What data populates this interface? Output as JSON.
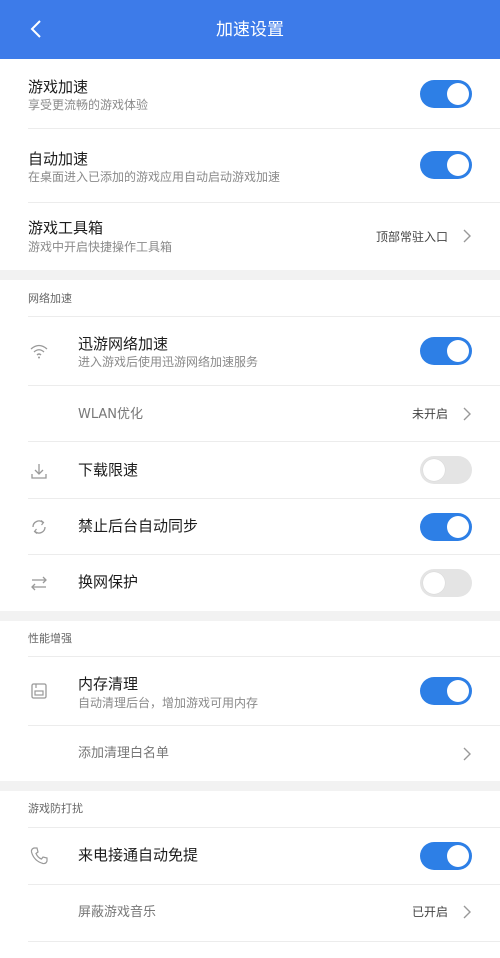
{
  "header": {
    "title": "加速设置"
  },
  "main": {
    "game_accel": {
      "title": "游戏加速",
      "sub": "享受更流畅的游戏体验",
      "on": true
    },
    "auto_accel": {
      "title": "自动加速",
      "sub": "在桌面进入已添加的游戏应用自动启动游戏加速",
      "on": true
    },
    "toolbox": {
      "title": "游戏工具箱",
      "sub": "游戏中开启快捷操作工具箱",
      "value": "顶部常驻入口"
    }
  },
  "network": {
    "section_title": "网络加速",
    "xunyou": {
      "title": "迅游网络加速",
      "sub": "进入游戏后使用迅游网络加速服务",
      "on": true,
      "icon": "wifi-icon"
    },
    "wlan": {
      "title": "WLAN优化",
      "value": "未开启"
    },
    "download_limit": {
      "title": "下载限速",
      "on": false,
      "icon": "download-icon"
    },
    "bg_sync": {
      "title": "禁止后台自动同步",
      "on": true,
      "icon": "sync-icon"
    },
    "net_switch": {
      "title": "换网保护",
      "on": false,
      "icon": "swap-icon"
    }
  },
  "performance": {
    "section_title": "性能增强",
    "memory": {
      "title": "内存清理",
      "sub": "自动清理后台，增加游戏可用内存",
      "on": true,
      "icon": "memory-icon"
    },
    "whitelist": {
      "title": "添加清理白名单"
    }
  },
  "disturb": {
    "section_title": "游戏防打扰",
    "call": {
      "title": "来电接通自动免提",
      "on": true,
      "icon": "phone-icon"
    },
    "music": {
      "title": "屏蔽游戏音乐",
      "value": "已开启"
    }
  },
  "colors": {
    "header": "#3d7be9",
    "toggle_on": "#2d7fe6",
    "toggle_off": "#e4e4e4"
  }
}
